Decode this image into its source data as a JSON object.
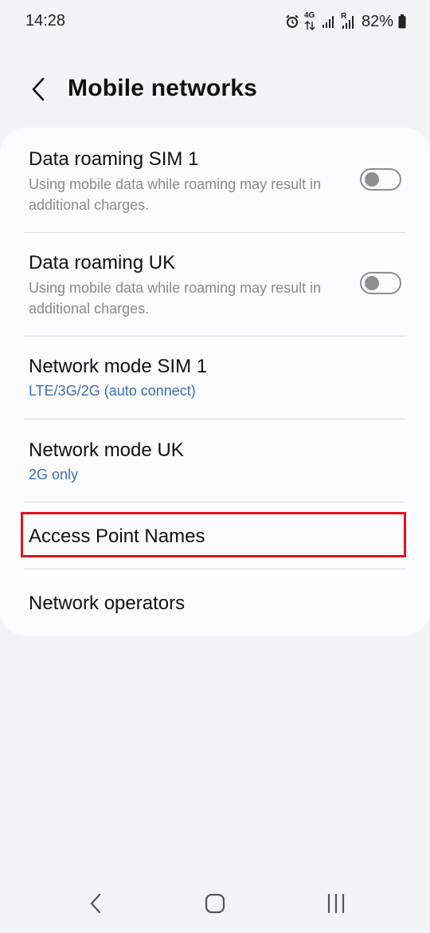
{
  "status_bar": {
    "time": "14:28",
    "network_type": "4G",
    "roaming_indicator": "R",
    "battery": "82%",
    "icons": [
      "alarm-icon",
      "4g-data-icon",
      "signal-icon",
      "roaming-signal-icon",
      "battery-icon"
    ]
  },
  "header": {
    "title": "Mobile networks",
    "back_icon": "chevron-left-icon"
  },
  "settings": {
    "data_roaming_sim1": {
      "title": "Data roaming SIM 1",
      "summary": "Using mobile data while roaming may result in additional charges.",
      "enabled": false
    },
    "data_roaming_uk": {
      "title": "Data roaming UK",
      "summary": "Using mobile data while roaming may result in additional charges.",
      "enabled": false
    },
    "network_mode_sim1": {
      "title": "Network mode SIM 1",
      "value": "LTE/3G/2G (auto connect)"
    },
    "network_mode_uk": {
      "title": "Network mode UK",
      "value": "2G only"
    },
    "access_point_names": {
      "title": "Access Point Names",
      "highlighted": true
    },
    "network_operators": {
      "title": "Network operators"
    }
  },
  "nav_bar": {
    "icons": [
      "back-nav-icon",
      "home-nav-icon",
      "recents-nav-icon"
    ]
  },
  "colors": {
    "background": "#f4f4f6",
    "card": "#fcfcfe",
    "accent_value": "#3b6fb8",
    "highlight": "#e0141e",
    "toggle_off": "#8e8e93"
  }
}
